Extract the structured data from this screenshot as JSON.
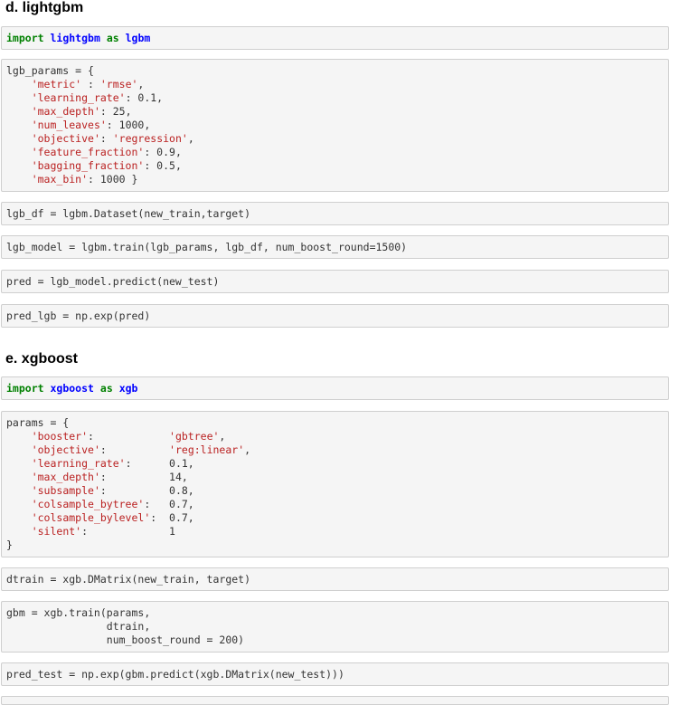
{
  "section_d": {
    "heading": "d. lightgbm",
    "cells": [
      [
        [
          {
            "t": "import",
            "c": "kw"
          },
          {
            "t": " "
          },
          {
            "t": "lightgbm",
            "c": "nn"
          },
          {
            "t": " "
          },
          {
            "t": "as",
            "c": "kw"
          },
          {
            "t": " "
          },
          {
            "t": "lgbm",
            "c": "nn"
          }
        ]
      ],
      [
        [
          {
            "t": "lgb_params = {"
          }
        ],
        [
          {
            "t": "    "
          },
          {
            "t": "'metric'",
            "c": "s"
          },
          {
            "t": " : "
          },
          {
            "t": "'rmse'",
            "c": "s"
          },
          {
            "t": ","
          }
        ],
        [
          {
            "t": "    "
          },
          {
            "t": "'learning_rate'",
            "c": "s"
          },
          {
            "t": ": 0.1,"
          }
        ],
        [
          {
            "t": "    "
          },
          {
            "t": "'max_depth'",
            "c": "s"
          },
          {
            "t": ": 25,"
          }
        ],
        [
          {
            "t": "    "
          },
          {
            "t": "'num_leaves'",
            "c": "s"
          },
          {
            "t": ": 1000,"
          }
        ],
        [
          {
            "t": "    "
          },
          {
            "t": "'objective'",
            "c": "s"
          },
          {
            "t": ": "
          },
          {
            "t": "'regression'",
            "c": "s"
          },
          {
            "t": ","
          }
        ],
        [
          {
            "t": "    "
          },
          {
            "t": "'feature_fraction'",
            "c": "s"
          },
          {
            "t": ": 0.9,"
          }
        ],
        [
          {
            "t": "    "
          },
          {
            "t": "'bagging_fraction'",
            "c": "s"
          },
          {
            "t": ": 0.5,"
          }
        ],
        [
          {
            "t": "    "
          },
          {
            "t": "'max_bin'",
            "c": "s"
          },
          {
            "t": ": 1000 }"
          }
        ]
      ],
      [
        [
          {
            "t": "lgb_df = lgbm.Dataset(new_train,target)"
          }
        ]
      ],
      [
        [
          {
            "t": "lgb_model = lgbm.train(lgb_params, lgb_df, num_boost_round=1500)"
          }
        ]
      ],
      [
        [
          {
            "t": "pred = lgb_model.predict(new_test)"
          }
        ]
      ],
      [
        [
          {
            "t": "pred_lgb = np.exp(pred)"
          }
        ]
      ]
    ]
  },
  "section_e": {
    "heading": "e. xgboost",
    "cells": [
      [
        [
          {
            "t": "import",
            "c": "kw"
          },
          {
            "t": " "
          },
          {
            "t": "xgboost",
            "c": "nn"
          },
          {
            "t": " "
          },
          {
            "t": "as",
            "c": "kw"
          },
          {
            "t": " "
          },
          {
            "t": "xgb",
            "c": "nn"
          }
        ]
      ],
      [
        [
          {
            "t": "params = {"
          }
        ],
        [
          {
            "t": "    "
          },
          {
            "t": "'booster'",
            "c": "s"
          },
          {
            "t": ":            "
          },
          {
            "t": "'gbtree'",
            "c": "s"
          },
          {
            "t": ","
          }
        ],
        [
          {
            "t": "    "
          },
          {
            "t": "'objective'",
            "c": "s"
          },
          {
            "t": ":          "
          },
          {
            "t": "'reg:linear'",
            "c": "s"
          },
          {
            "t": ","
          }
        ],
        [
          {
            "t": "    "
          },
          {
            "t": "'learning_rate'",
            "c": "s"
          },
          {
            "t": ":      0.1,"
          }
        ],
        [
          {
            "t": "    "
          },
          {
            "t": "'max_depth'",
            "c": "s"
          },
          {
            "t": ":          14,"
          }
        ],
        [
          {
            "t": "    "
          },
          {
            "t": "'subsample'",
            "c": "s"
          },
          {
            "t": ":          0.8,"
          }
        ],
        [
          {
            "t": "    "
          },
          {
            "t": "'colsample_bytree'",
            "c": "s"
          },
          {
            "t": ":   0.7,"
          }
        ],
        [
          {
            "t": "    "
          },
          {
            "t": "'colsample_bylevel'",
            "c": "s"
          },
          {
            "t": ":  0.7,"
          }
        ],
        [
          {
            "t": "    "
          },
          {
            "t": "'silent'",
            "c": "s"
          },
          {
            "t": ":             1"
          }
        ],
        [
          {
            "t": "}"
          }
        ]
      ],
      [
        [
          {
            "t": "dtrain = xgb.DMatrix(new_train, target)"
          }
        ]
      ],
      [
        [
          {
            "t": "gbm = xgb.train(params,"
          }
        ],
        [
          {
            "t": "                dtrain,"
          }
        ],
        [
          {
            "t": "                num_boost_round = 200)"
          }
        ]
      ],
      [
        [
          {
            "t": "pred_test = np.exp(gbm.predict(xgb.DMatrix(new_test)))"
          }
        ]
      ]
    ]
  }
}
